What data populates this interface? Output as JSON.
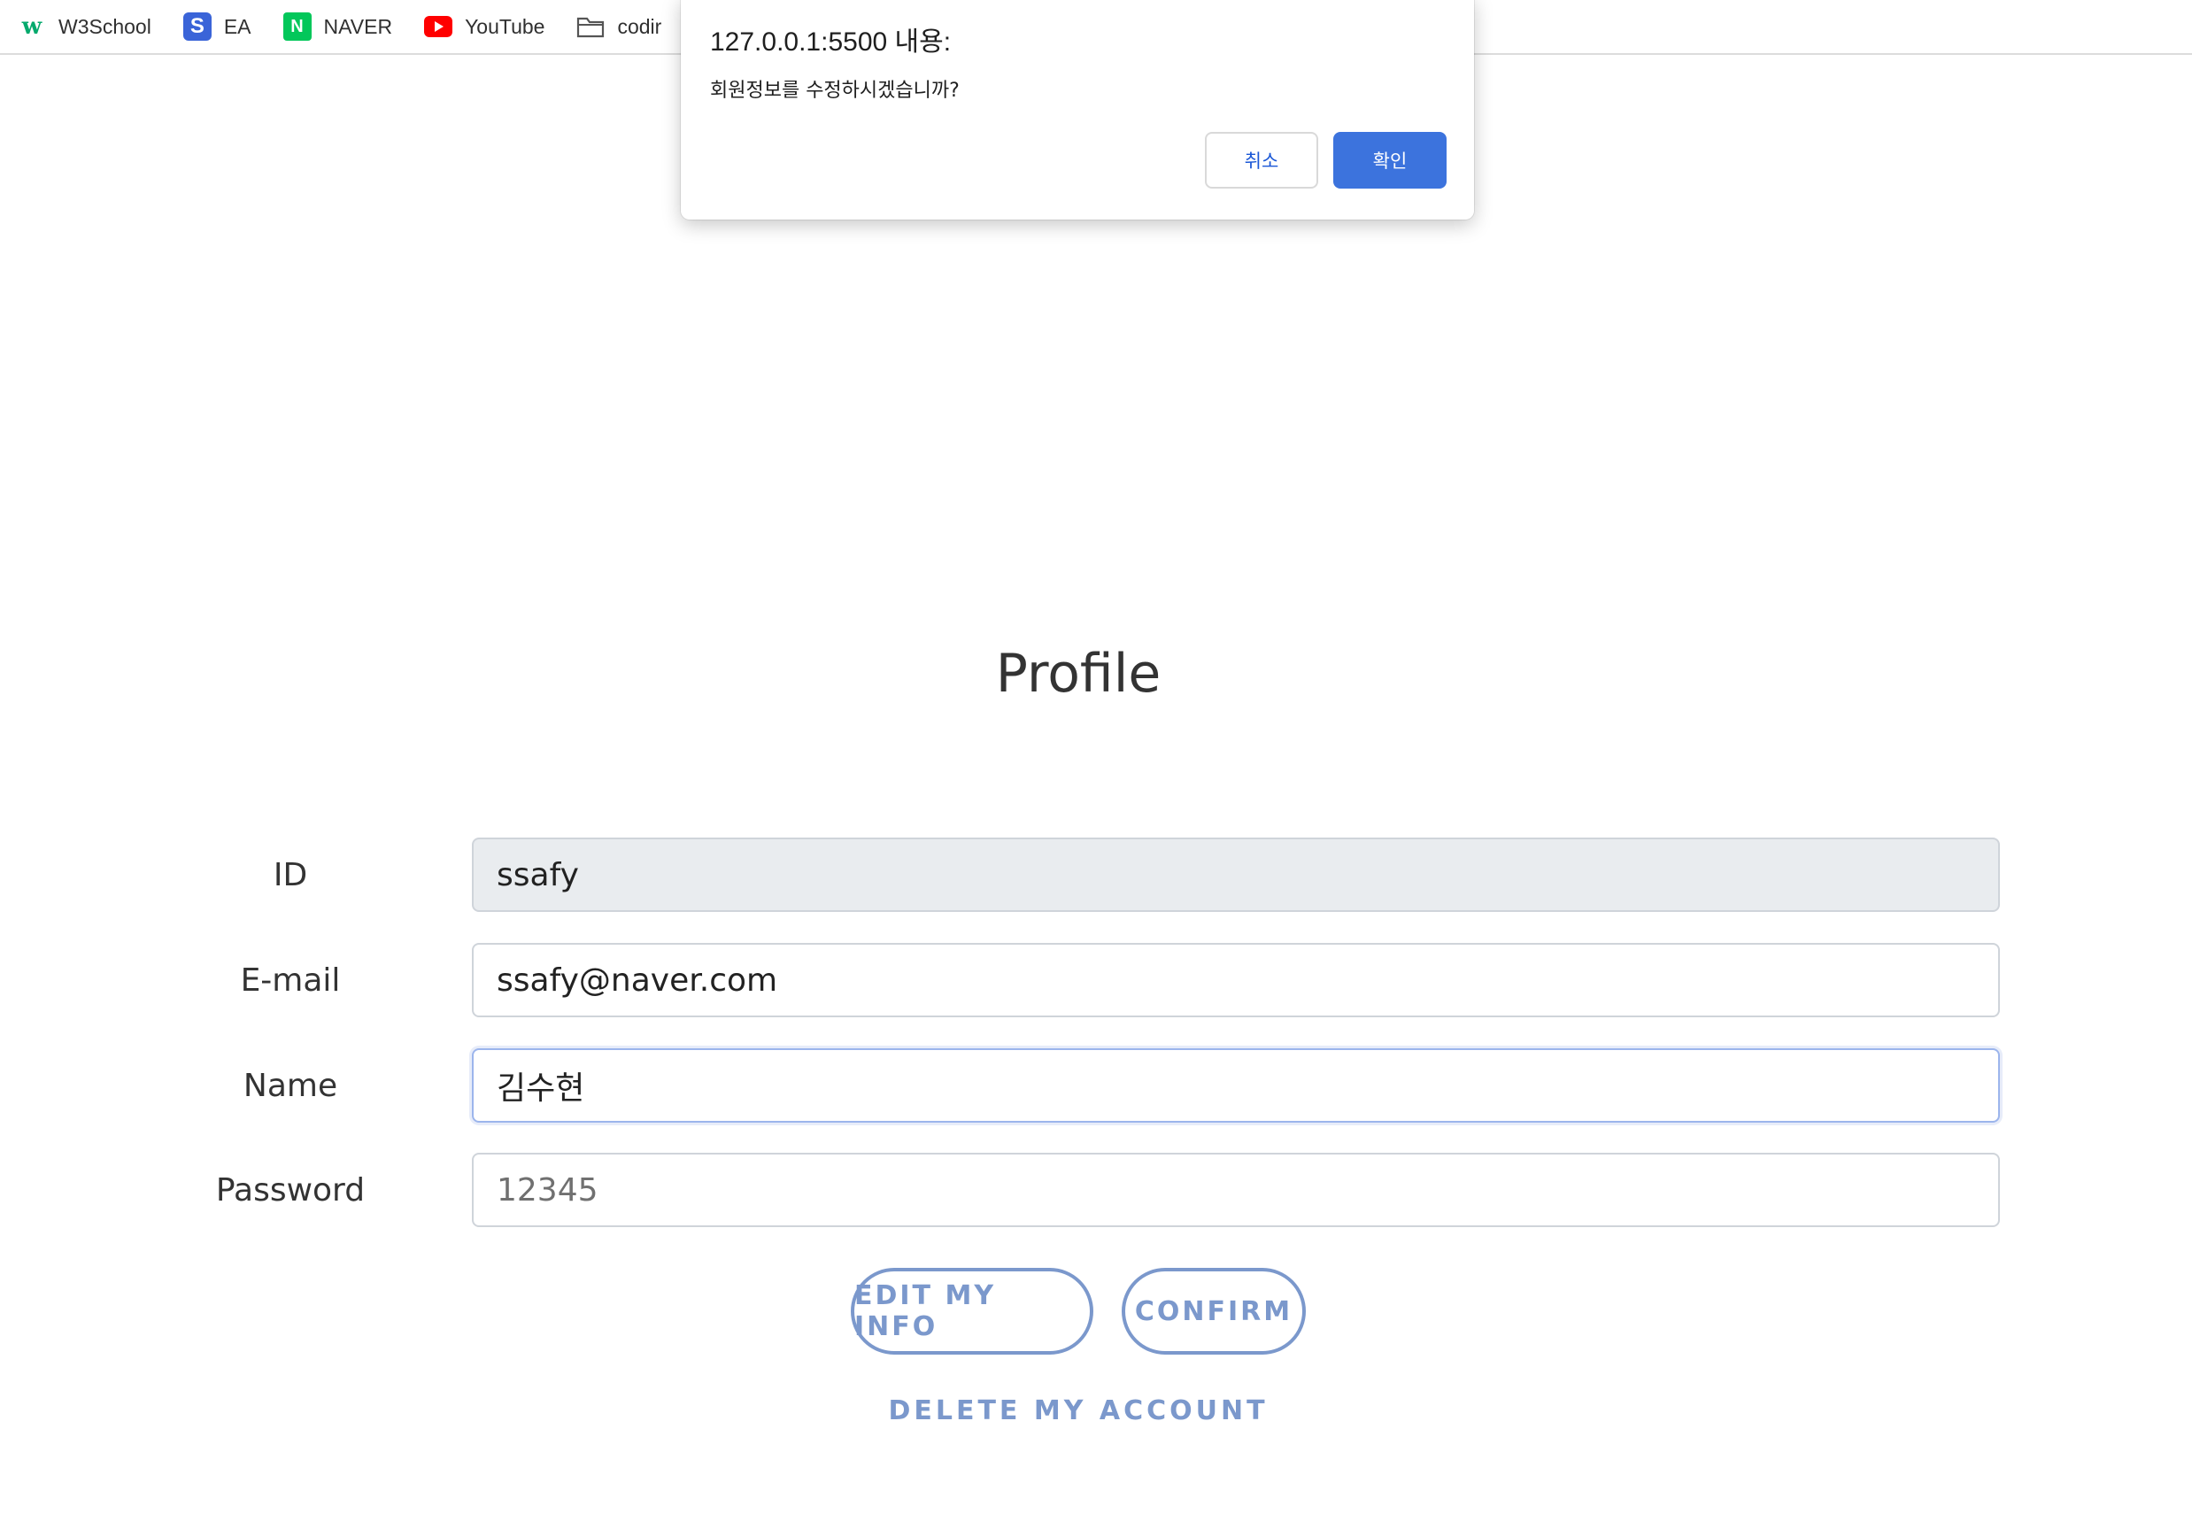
{
  "bookmarks": [
    {
      "label": "W3School",
      "icon": "w3schools-icon"
    },
    {
      "label": "EA",
      "icon": "ea-icon"
    },
    {
      "label": "NAVER",
      "icon": "naver-icon"
    },
    {
      "label": "YouTube",
      "icon": "youtube-icon"
    },
    {
      "label": "codir",
      "icon": "folder-icon"
    }
  ],
  "dialog": {
    "title": "127.0.0.1:5500 내용:",
    "message": "회원정보를 수정하시겠습니까?",
    "cancel_label": "취소",
    "ok_label": "확인"
  },
  "profile": {
    "title": "Profile",
    "fields": {
      "id": {
        "label": "ID",
        "value": "ssafy"
      },
      "email": {
        "label": "E-mail",
        "value": "ssafy@naver.com"
      },
      "name": {
        "label": "Name",
        "value": "김수현"
      },
      "password": {
        "label": "Password",
        "placeholder": "12345"
      }
    },
    "edit_button": "EDIT MY INFO",
    "confirm_button": "CONFIRM",
    "delete_link": "DELETE MY ACCOUNT"
  },
  "colors": {
    "accent": "#7b98cc",
    "dialog_ok": "#3c73dd",
    "readonly_bg": "#e9ecef"
  }
}
